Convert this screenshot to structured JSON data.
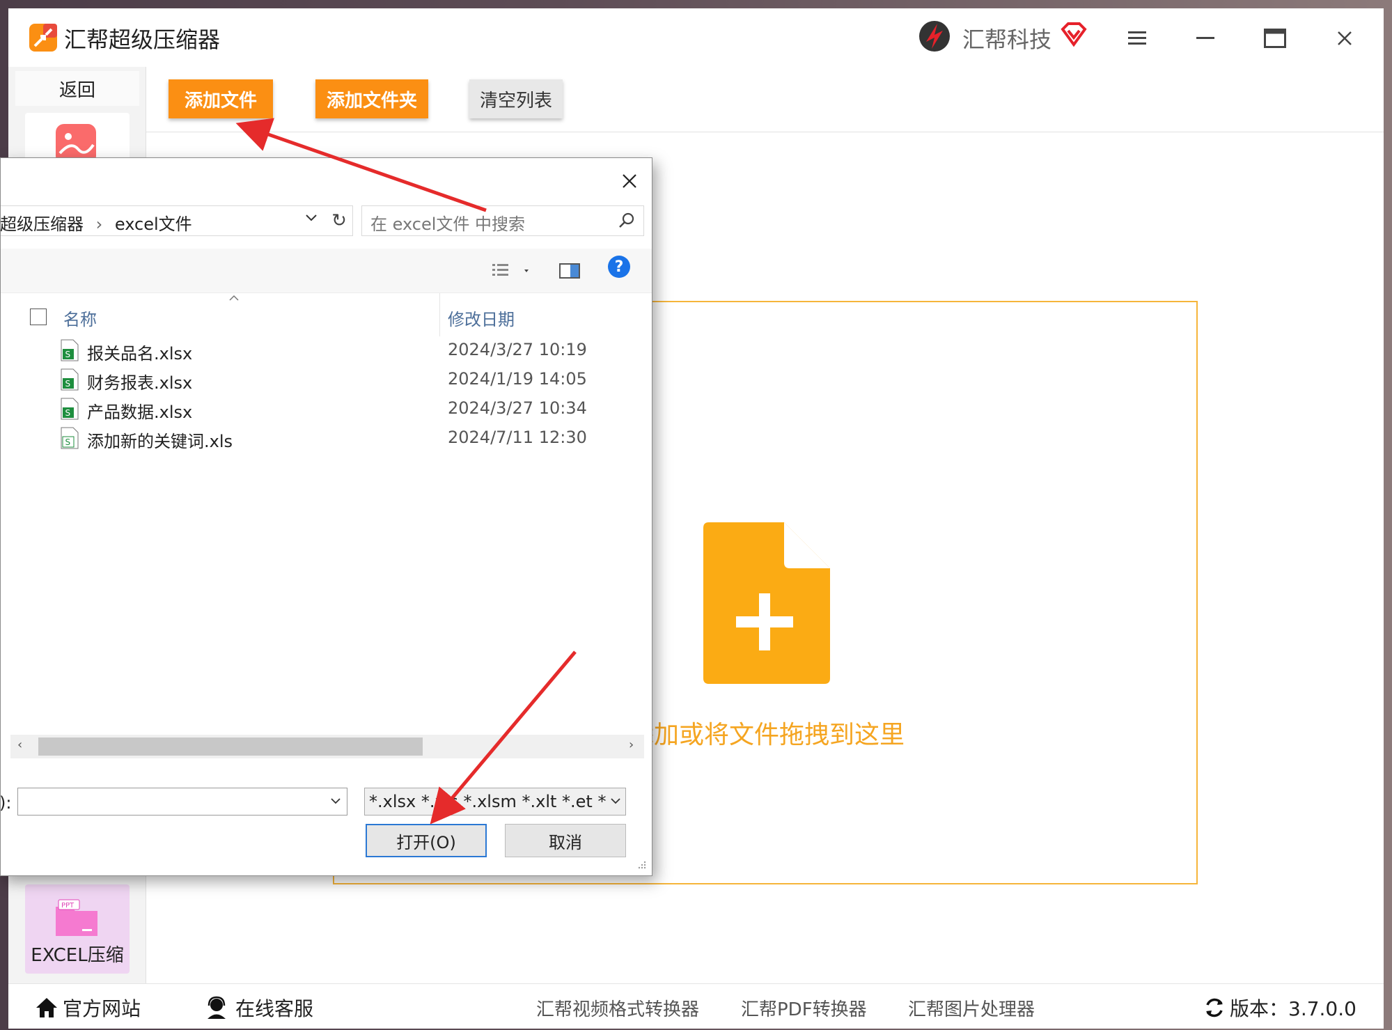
{
  "app": {
    "title": "汇帮超级压缩器",
    "brand": "汇帮科技",
    "accent_color": "#fb8f13",
    "drop_color": "#f6b53a"
  },
  "sidebar": {
    "back_label": "返回",
    "tiles": [
      {
        "icon": "image-compress-icon",
        "label": ""
      },
      {
        "icon": "ppt-folder-icon",
        "label": "EXCEL压缩",
        "active": true
      }
    ]
  },
  "toolbar": {
    "add_file": "添加文件",
    "add_folder": "添加文件夹",
    "clear_list": "清空列表"
  },
  "dropzone": {
    "icon": "file-add-icon",
    "text": "添加或将文件拖拽到这里"
  },
  "bottombar": {
    "website": "官方网站",
    "service": "在线客服",
    "links": [
      "汇帮视频格式转换器",
      "汇帮PDF转换器",
      "汇帮图片处理器"
    ],
    "version": "版本：3.7.0.0"
  },
  "dialog": {
    "path": "超级压缩器",
    "folder": "excel文件",
    "search_placeholder": "在 excel文件 中搜索",
    "col_name": "名称",
    "col_date": "修改日期",
    "files": [
      {
        "name": "报关品名.xlsx",
        "date": "2024/3/27 10:19"
      },
      {
        "name": "财务报表.xlsx",
        "date": "2024/1/19 14:05"
      },
      {
        "name": "产品数据.xlsx",
        "date": "2024/3/27 10:34"
      },
      {
        "name": "添加新的关键词.xls",
        "date": "2024/7/11 12:30"
      }
    ],
    "filename_label": "):",
    "filename_value": "",
    "filter_value": "*.xlsx *.xls *.xlsm *.xlt *.et *.ett",
    "open_label": "打开(O)",
    "cancel_label": "取消"
  }
}
